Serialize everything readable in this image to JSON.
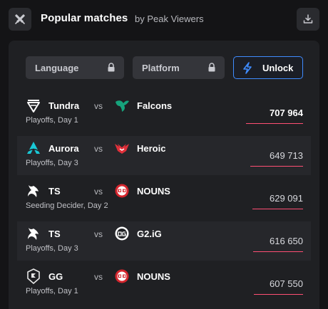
{
  "header": {
    "title": "Popular matches",
    "subtitle": "by Peak Viewers"
  },
  "filters": {
    "language_label": "Language",
    "platform_label": "Platform",
    "unlock_label": "Unlock"
  },
  "colors": {
    "accent_blue": "#3f8cff",
    "viewer_bar": "#ff4f74",
    "falcons_green": "#16a37c",
    "aurora_cyan": "#19c8d6",
    "heroic_red": "#e0303a",
    "nouns_red": "#d4252d"
  },
  "matches": [
    {
      "team1": "Tundra",
      "team1_icon": "tundra-logo-icon",
      "vs": "vs",
      "team2": "Falcons",
      "team2_icon": "falcons-logo-icon",
      "stage": "Playoffs, Day 1",
      "viewers": "707 964",
      "viewers_fraction": 1.0
    },
    {
      "team1": "Aurora",
      "team1_icon": "aurora-logo-icon",
      "vs": "vs",
      "team2": "Heroic",
      "team2_icon": "heroic-logo-icon",
      "stage": "Playoffs, Day 3",
      "viewers": "649 713",
      "viewers_fraction": 0.92
    },
    {
      "team1": "TS",
      "team1_icon": "ts-logo-icon",
      "vs": "vs",
      "team2": "NOUNS",
      "team2_icon": "nouns-logo-icon",
      "stage": "Seeding Decider, Day 2",
      "viewers": "629 091",
      "viewers_fraction": 0.89
    },
    {
      "team1": "TS",
      "team1_icon": "ts-logo-icon",
      "vs": "vs",
      "team2": "G2.iG",
      "team2_icon": "g2ig-logo-icon",
      "stage": "Playoffs, Day 3",
      "viewers": "616 650",
      "viewers_fraction": 0.87
    },
    {
      "team1": "GG",
      "team1_icon": "gg-logo-icon",
      "vs": "vs",
      "team2": "NOUNS",
      "team2_icon": "nouns-logo-icon",
      "stage": "Playoffs, Day 1",
      "viewers": "607 550",
      "viewers_fraction": 0.86
    }
  ]
}
